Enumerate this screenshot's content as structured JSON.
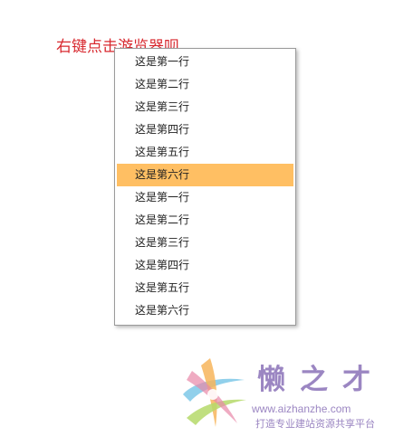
{
  "page": {
    "instruction": "右键点击游览器呗"
  },
  "context_menu": {
    "items": [
      {
        "label": "这是第一行",
        "highlighted": false
      },
      {
        "label": "这是第二行",
        "highlighted": false
      },
      {
        "label": "这是第三行",
        "highlighted": false
      },
      {
        "label": "这是第四行",
        "highlighted": false
      },
      {
        "label": "这是第五行",
        "highlighted": false
      },
      {
        "label": "这是第六行",
        "highlighted": true
      },
      {
        "label": "这是第一行",
        "highlighted": false
      },
      {
        "label": "这是第二行",
        "highlighted": false
      },
      {
        "label": "这是第三行",
        "highlighted": false
      },
      {
        "label": "这是第四行",
        "highlighted": false
      },
      {
        "label": "这是第五行",
        "highlighted": false
      },
      {
        "label": "这是第六行",
        "highlighted": false
      }
    ],
    "highlight_color": "#ffbf63"
  },
  "watermark": {
    "brand": "懒之才",
    "url": "www.aizhanzhe.com",
    "slogan": "打造专业建站资源共享平台",
    "logo_icon": "star-swirl-logo-icon",
    "brand_color": "#9b86c2"
  }
}
